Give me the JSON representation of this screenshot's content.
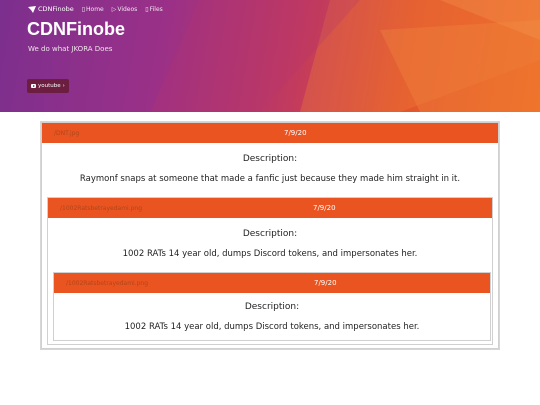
{
  "nav": {
    "brand": "CDNFinobe",
    "links": [
      {
        "label": "Home",
        "icon": "home-icon"
      },
      {
        "label": "Videos",
        "icon": "video-icon"
      },
      {
        "label": "Files",
        "icon": "file-icon"
      }
    ]
  },
  "hero": {
    "title": "CDNFinobe",
    "tagline": "We do what JKORA Does",
    "youtube_label": "youtube",
    "youtube_icon": "youtube-icon"
  },
  "entries": [
    {
      "link": "/DNT.jpg",
      "date": "7/9/20",
      "desc_label": "Description:",
      "description": "Raymonf snaps at someone that made a fanfic just because they made him straight in it."
    },
    {
      "link": "/1002Ratsbetrayedami.png",
      "date": "7/9/20",
      "desc_label": "Description:",
      "description": "1002 RATs 14 year old, dumps Discord tokens, and impersonates her."
    },
    {
      "link": "/1002Ratsbetrayedami.png",
      "date": "7/9/20",
      "desc_label": "Description:",
      "description": "1002 RATs 14 year old, dumps Discord tokens, and impersonates her."
    }
  ],
  "colors": {
    "accent": "#e95420",
    "hero_start": "#7c2f8e",
    "hero_end": "#ee6a22",
    "button": "#6b1e3f"
  }
}
